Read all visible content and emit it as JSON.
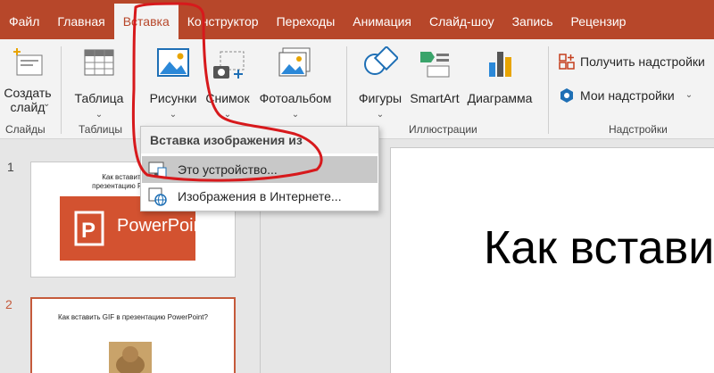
{
  "tabs": [
    "Файл",
    "Главная",
    "Вставка",
    "Конструктор",
    "Переходы",
    "Анимация",
    "Слайд-шоу",
    "Запись",
    "Рецензир"
  ],
  "active_tab": "Вставка",
  "ribbon": {
    "create_slide_line1": "Создать",
    "create_slide_line2": "слайд",
    "table": "Таблица",
    "pictures": "Рисунки",
    "screenshot": "Снимок",
    "photo_album": "Фотоальбом",
    "shapes": "Фигуры",
    "smartart": "SmartArt",
    "chart": "Диаграмма",
    "get_addins": "Получить надстройки",
    "my_addins": "Мои надстройки",
    "groups": {
      "slides": "Слайды",
      "tables": "Таблицы",
      "illustrations": "Иллюстрации",
      "addins": "Надстройки"
    }
  },
  "dropdown": {
    "header": "Вставка изображения из",
    "item_device": "Это устройство...",
    "item_online": "Изображения в Интернете..."
  },
  "slides": {
    "num1": "1",
    "num2": "2",
    "thumb1_title": "Как вставить GIF в презентацию PowerPoint",
    "thumb1_logo": "PowerPoint",
    "thumb2_title": "Как вставить GIF в презентацию PowerPoint?"
  },
  "main_slide_title": "Как встави",
  "colors": {
    "accent": "#b7472a",
    "annotation": "#d7191c"
  }
}
